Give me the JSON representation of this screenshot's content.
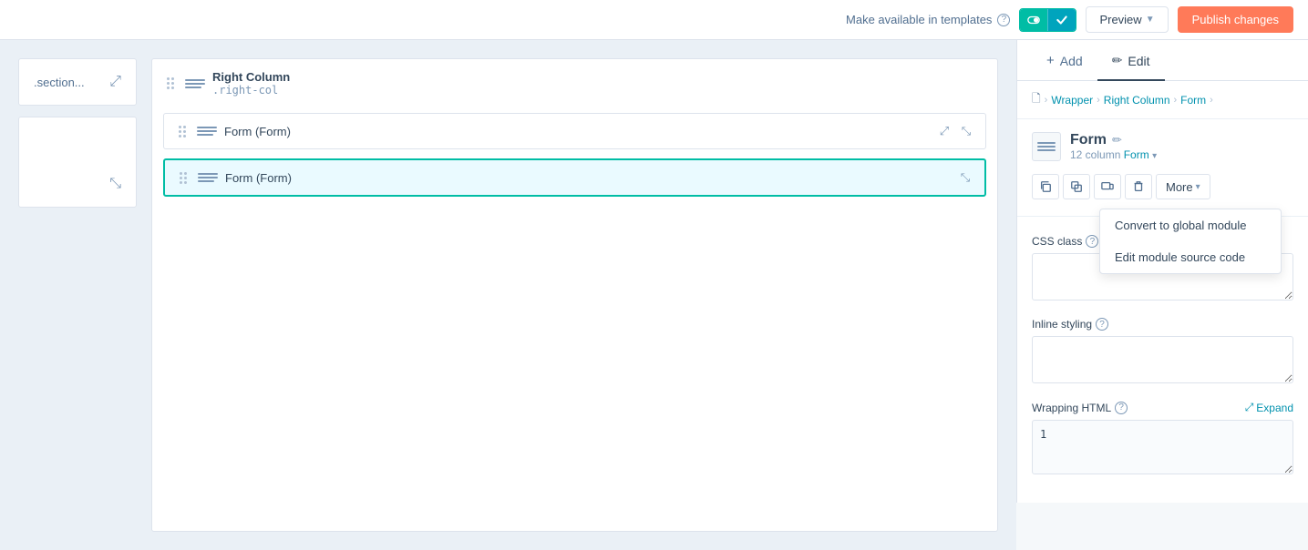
{
  "topbar": {
    "make_available_label": "Make available in templates",
    "preview_label": "Preview",
    "publish_label": "Publish changes"
  },
  "breadcrumb": {
    "page_icon": "🗋",
    "items": [
      "Wrapper",
      "Right Column",
      "Form"
    ],
    "trailing_arrow": ">"
  },
  "module": {
    "name": "Form",
    "subtitle": "12 column",
    "form_link": "Form",
    "toolbar": {
      "copy_title": "Copy",
      "clone_title": "Clone",
      "responsive_title": "Responsive",
      "delete_title": "Delete",
      "more_label": "More"
    },
    "dropdown": {
      "item1": "Convert to global module",
      "item2": "Edit module source code"
    }
  },
  "fields": {
    "css_class_label": "CSS class",
    "css_class_placeholder": "",
    "inline_styling_label": "Inline styling",
    "inline_styling_placeholder": "",
    "wrapping_html_label": "Wrapping HTML",
    "expand_label": "Expand",
    "code_line": "1"
  },
  "canvas": {
    "section_label": ".section...",
    "right_col_title": "Right Column",
    "right_col_subtitle": ".right-col",
    "form1_label": "Form (Form)",
    "form2_label": "Form (Form)"
  },
  "colors": {
    "accent": "#00bda5",
    "orange": "#ff7a59",
    "active_border": "#00bda5",
    "active_bg": "#eafaff"
  }
}
